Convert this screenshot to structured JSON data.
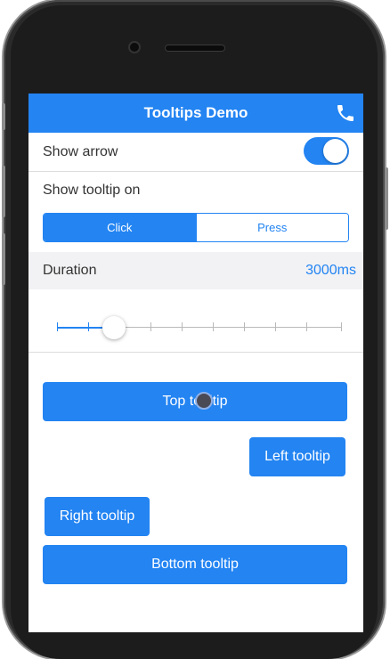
{
  "app": {
    "title": "Tooltips Demo",
    "accent_color": "#2384f2",
    "nav_right_icon": "phone-icon"
  },
  "settings": {
    "show_arrow_label": "Show arrow",
    "show_arrow_on": true,
    "show_tooltip_on_label": "Show tooltip on",
    "trigger_options": [
      "Click",
      "Press"
    ],
    "trigger_selected": "Click",
    "duration_label": "Duration",
    "duration_value": "3000ms",
    "duration_slider_fraction": 0.2
  },
  "buttons": {
    "top": "Top tooltip",
    "left": "Left tooltip",
    "right": "Right tooltip",
    "bottom": "Bottom tooltip"
  }
}
